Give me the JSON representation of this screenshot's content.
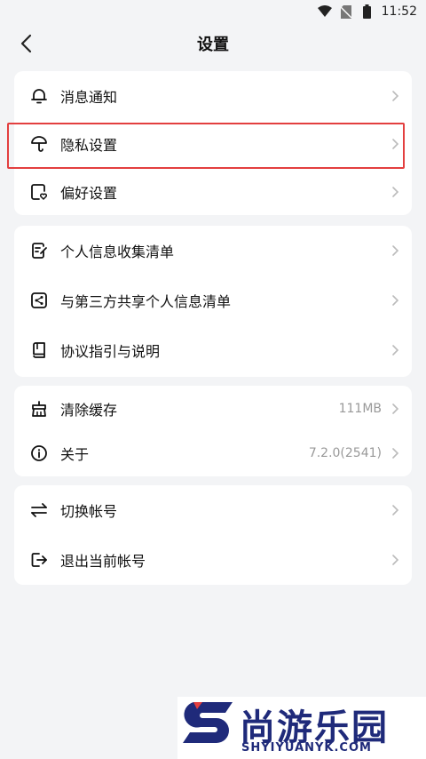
{
  "status_bar": {
    "time": "11:52",
    "icons": [
      "wifi-icon",
      "no-sim-icon",
      "battery-icon"
    ]
  },
  "header": {
    "title": "设置",
    "back_icon": "chevron-left-icon"
  },
  "groups": [
    {
      "items": [
        {
          "label": "消息通知",
          "icon": "bell-icon",
          "value": ""
        },
        {
          "label": "隐私设置",
          "icon": "umbrella-icon",
          "value": "",
          "highlighted": true
        },
        {
          "label": "偏好设置",
          "icon": "heart-card-icon",
          "value": ""
        }
      ]
    },
    {
      "items": [
        {
          "label": "个人信息收集清单",
          "icon": "document-edit-icon",
          "value": ""
        },
        {
          "label": "与第三方共享个人信息清单",
          "icon": "share-icon",
          "value": ""
        },
        {
          "label": "协议指引与说明",
          "icon": "book-icon",
          "value": ""
        }
      ]
    },
    {
      "items": [
        {
          "label": "清除缓存",
          "icon": "broom-basket-icon",
          "value": "111MB"
        },
        {
          "label": "关于",
          "icon": "info-icon",
          "value": "7.2.0(2541)"
        }
      ]
    },
    {
      "items": [
        {
          "label": "切换帐号",
          "icon": "switch-arrows-icon",
          "value": ""
        },
        {
          "label": "退出当前帐号",
          "icon": "logout-icon",
          "value": ""
        }
      ]
    }
  ],
  "watermark": {
    "title": "尚游乐园",
    "subtitle": "SHYIYUANYK.COM"
  },
  "colors": {
    "background": "#f3f4f6",
    "card": "#ffffff",
    "highlight_border": "#e33f3f",
    "watermark_blue": "#1f2a7a"
  }
}
